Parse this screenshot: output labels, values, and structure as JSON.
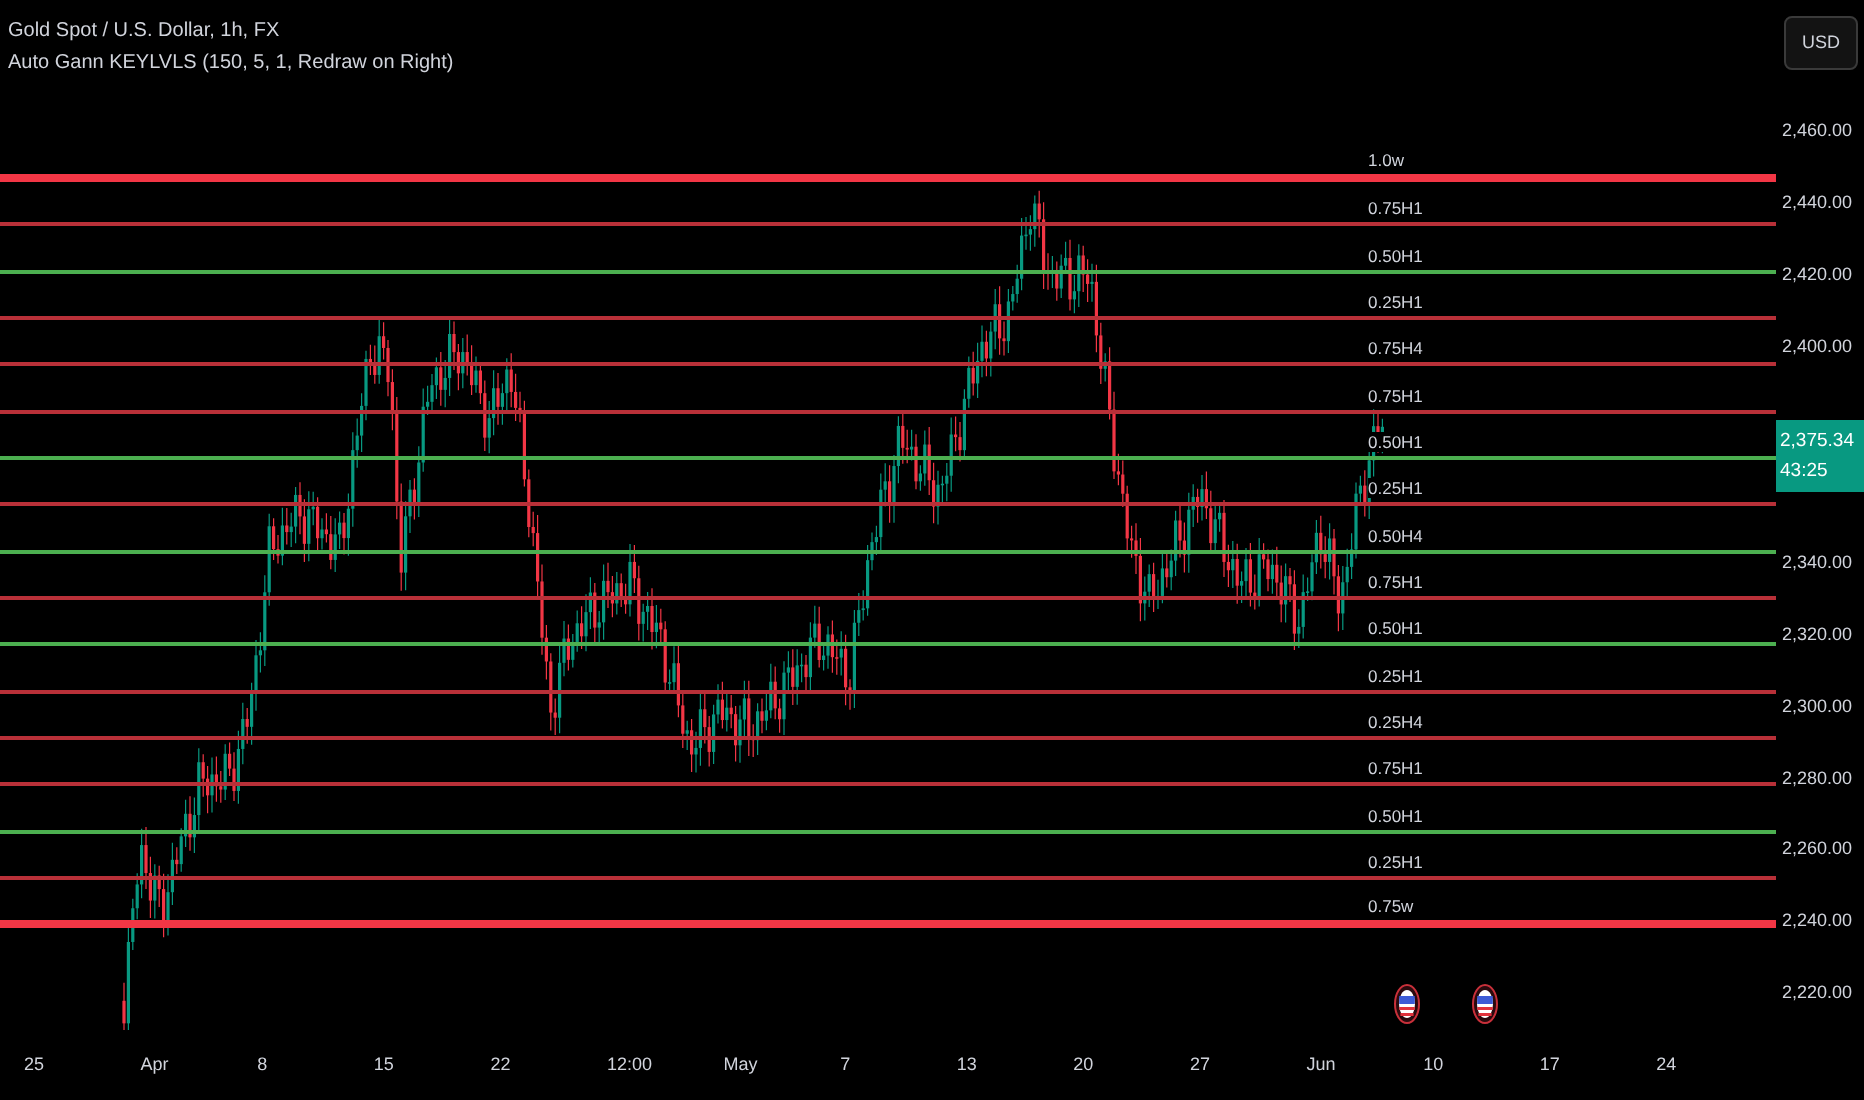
{
  "chart": {
    "title": "Gold Spot / U.S. Dollar, 1h, FX",
    "indicator": "Auto Gann KEYLVLS (150, 5, 1, Redraw on Right)"
  },
  "currency_button": "USD",
  "levels": [
    {
      "label": "1.0w",
      "kind": "major",
      "color": "#f23645"
    },
    {
      "label": "0.75H1",
      "kind": "minor",
      "color": "#b83038"
    },
    {
      "label": "0.50H1",
      "kind": "minor",
      "color": "#4caf50"
    },
    {
      "label": "0.25H1",
      "kind": "minor",
      "color": "#b83038"
    },
    {
      "label": "0.75H4",
      "kind": "minor",
      "color": "#b83038"
    },
    {
      "label": "0.75H1",
      "kind": "minor",
      "color": "#b83038"
    },
    {
      "label": "0.50H1",
      "kind": "minor",
      "color": "#4caf50"
    },
    {
      "label": "0.25H1",
      "kind": "minor",
      "color": "#b83038"
    },
    {
      "label": "0.50H4",
      "kind": "minor",
      "color": "#4caf50"
    },
    {
      "label": "0.75H1",
      "kind": "minor",
      "color": "#b83038"
    },
    {
      "label": "0.50H1",
      "kind": "minor",
      "color": "#4caf50"
    },
    {
      "label": "0.25H1",
      "kind": "minor",
      "color": "#b83038"
    },
    {
      "label": "0.25H4",
      "kind": "minor",
      "color": "#b83038"
    },
    {
      "label": "0.75H1",
      "kind": "minor",
      "color": "#b83038"
    },
    {
      "label": "0.50H1",
      "kind": "minor",
      "color": "#4caf50"
    },
    {
      "label": "0.25H1",
      "kind": "minor",
      "color": "#b83038"
    },
    {
      "label": "0.75w",
      "kind": "major",
      "color": "#f23645"
    }
  ],
  "price_axis": [
    {
      "kind": "tick",
      "label": "2,460.00"
    },
    {
      "kind": "tick",
      "label": "2,440.00"
    },
    {
      "kind": "tick",
      "label": "2,420.00"
    },
    {
      "kind": "tick",
      "label": "2,400.00"
    },
    {
      "kind": "price",
      "label": "2,375.34",
      "countdown": "43:25"
    },
    {
      "kind": "tick",
      "label": "2,340.00"
    },
    {
      "kind": "tick",
      "label": "2,320.00"
    },
    {
      "kind": "tick",
      "label": "2,300.00"
    },
    {
      "kind": "tick",
      "label": "2,280.00"
    },
    {
      "kind": "tick",
      "label": "2,260.00"
    },
    {
      "kind": "tick",
      "label": "2,240.00"
    },
    {
      "kind": "tick",
      "label": "2,220.00"
    }
  ],
  "time_axis": [
    "25",
    "Apr",
    "8",
    "15",
    "22",
    "12:00",
    "May",
    "7",
    "13",
    "20",
    "27",
    "Jun",
    "10",
    "17",
    "24"
  ]
}
